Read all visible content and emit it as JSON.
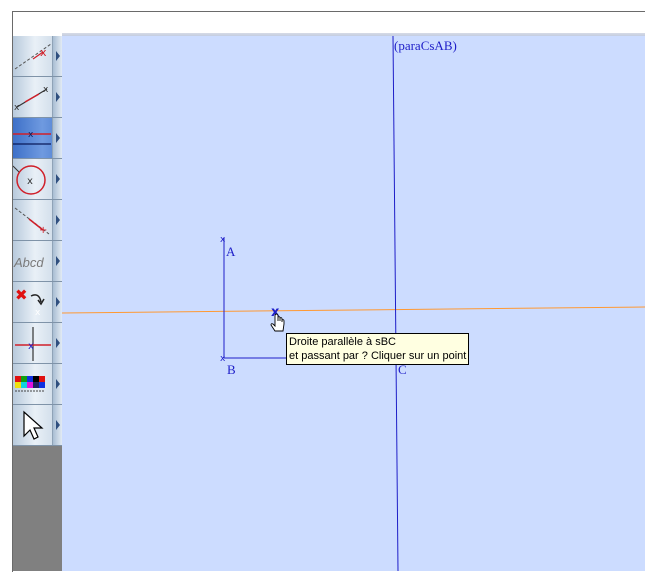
{
  "colors": {
    "canvas_bg": "#ccdcff",
    "line_blue": "#1e1ec8",
    "line_orange": "#ff9933",
    "toolbar_bg": "#808080",
    "tooltip_bg": "#ffffe1",
    "active_tool": "#4f80d0"
  },
  "toolbar": {
    "tools": [
      {
        "icon": "line-icon"
      },
      {
        "icon": "segment-icon"
      },
      {
        "icon": "parallel-line-icon",
        "active": true
      },
      {
        "icon": "circle-icon"
      },
      {
        "icon": "point-on-line-icon"
      },
      {
        "icon": "text-label-icon",
        "text": "Abcd"
      },
      {
        "icon": "delete-icon"
      },
      {
        "icon": "intersection-icon"
      },
      {
        "icon": "color-palette-icon"
      },
      {
        "icon": "pointer-arrow-icon"
      }
    ]
  },
  "figure": {
    "points": [
      {
        "name": "A"
      },
      {
        "name": "B"
      },
      {
        "name": "C"
      }
    ],
    "line_label": "(paraCsAB)"
  },
  "tooltip": {
    "line1": "Droite parallèle à sBC",
    "line2": "et passant par ? Cliquer sur un point"
  }
}
